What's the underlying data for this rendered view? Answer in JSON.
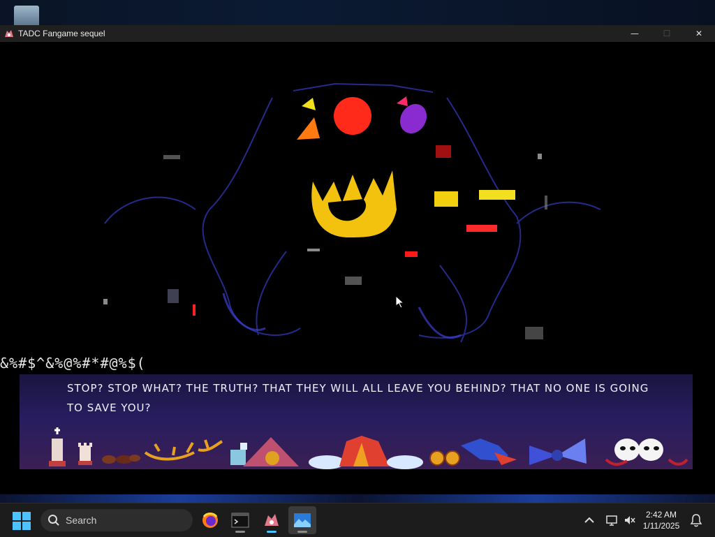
{
  "window": {
    "title": "TADC Fangame sequel",
    "controls": {
      "minimize": "—",
      "maximize": "☐",
      "close": "✕"
    }
  },
  "game": {
    "glitch_text": "&%#$^&%@%#*#@%$(",
    "dialog_text": "STOP? STOP WHAT? THE TRUTH? THAT THEY WILL ALL LEAVE YOU BEHIND? THAT NO ONE IS GOING TO SAVE YOU?",
    "dialog_icons": [
      "chess-king-icon",
      "chess-rook-icon",
      "acorn-icons",
      "antlers-icon",
      "cup-icon",
      "tent-icon",
      "cloud-tent-icon",
      "candy-icon",
      "bow-icon",
      "masks-icon"
    ]
  },
  "taskbar": {
    "search_placeholder": "Search",
    "apps": [
      "firefox-icon",
      "terminal-icon",
      "tadc-game-icon",
      "photos-icon"
    ],
    "clock_time": "2:42 AM",
    "clock_date": "1/11/2025"
  },
  "colors": {
    "titlebar": "#202020",
    "taskbar": "#1c1c1c",
    "dialog_top": "#1a1540",
    "dialog_bottom": "#3b1f55",
    "accent": "#4cc2ff"
  }
}
